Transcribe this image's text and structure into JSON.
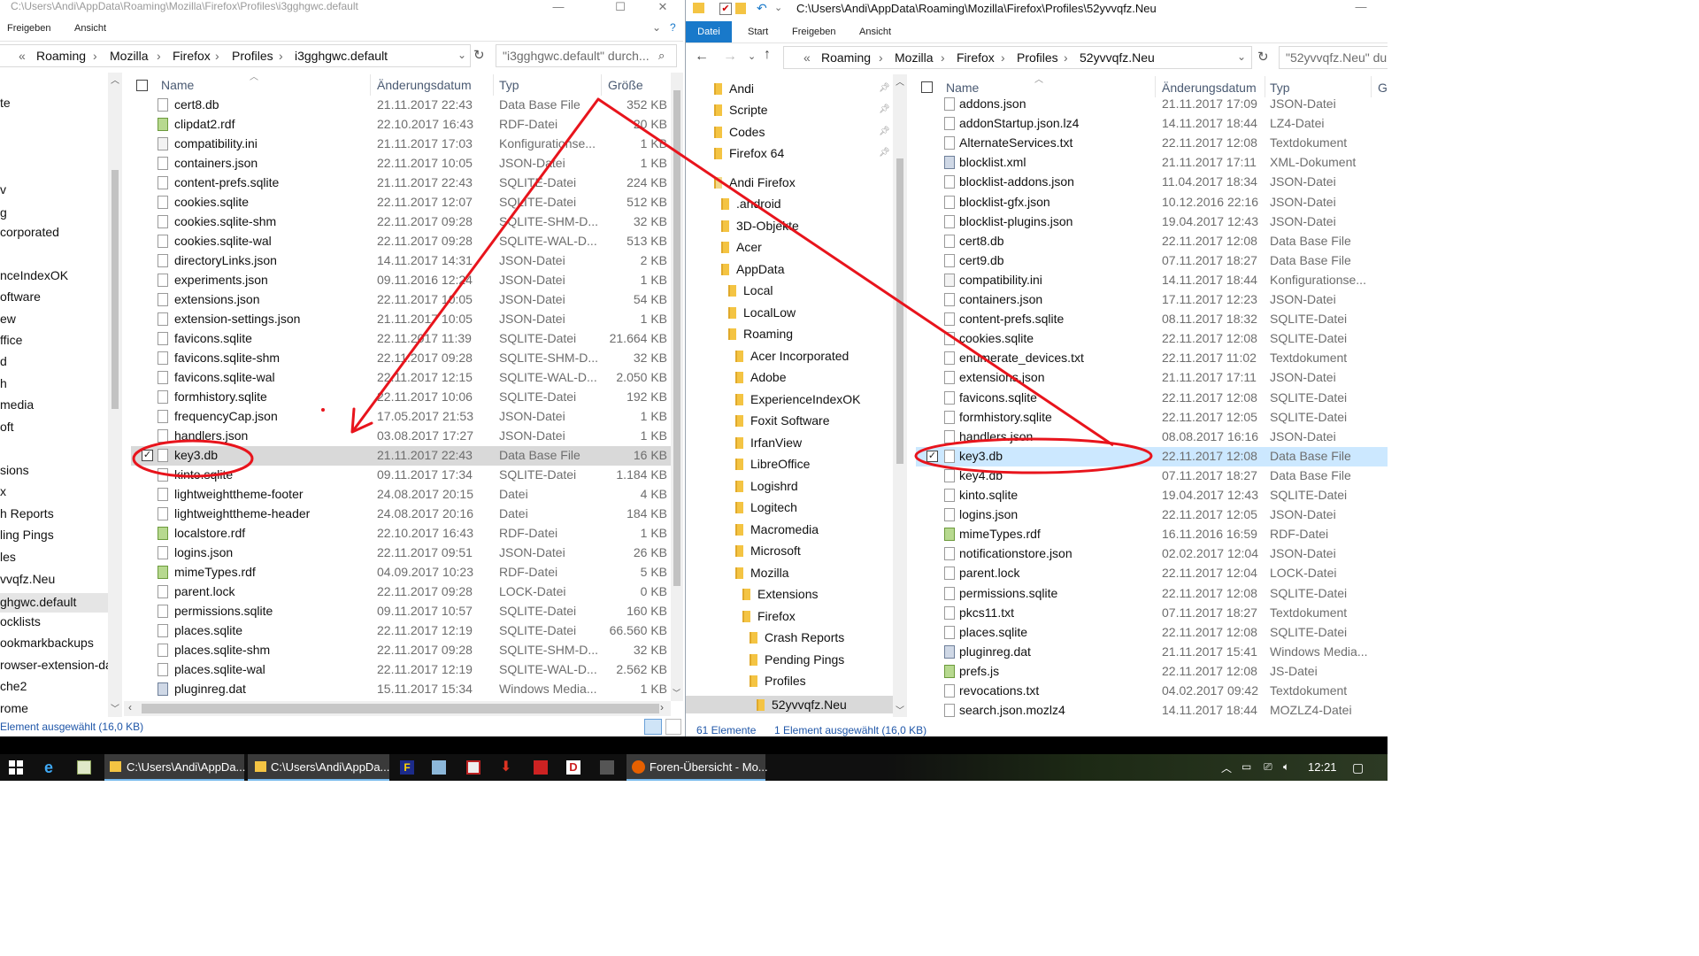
{
  "left_window": {
    "title": "C:\\Users\\Andi\\AppData\\Roaming\\Mozilla\\Firefox\\Profiles\\i3gghgwc.default",
    "ribbon_tabs": [
      "Freigeben",
      "Ansicht"
    ],
    "breadcrumb": [
      "«",
      "Roaming",
      "Mozilla",
      "Firefox",
      "Profiles",
      "i3gghgwc.default"
    ],
    "search_placeholder": "\"i3gghgwc.default\" durch...",
    "nav_items": [
      "te",
      "v",
      "g",
      "corporated",
      "nceIndexOK",
      "oftware",
      "ew",
      "ffice",
      "d",
      "h",
      "media",
      "oft",
      "sions",
      "x",
      "h Reports",
      "ling Pings",
      "les",
      "vvqfz.Neu",
      "ghgwc.default",
      "ocklists",
      "ookmarkbackups",
      "rowser-extension-da",
      "che2",
      "rome"
    ],
    "selected_nav": "ghgwc.default",
    "columns": {
      "name": "Name",
      "date": "Änderungsdatum",
      "type": "Typ",
      "size": "Größe"
    },
    "files": [
      {
        "name": "cert8.db",
        "date": "21.11.2017 22:43",
        "type": "Data Base File",
        "size": "352 KB",
        "icon": "db"
      },
      {
        "name": "clipdat2.rdf",
        "date": "22.10.2017 16:43",
        "type": "RDF-Datei",
        "size": "20 KB",
        "icon": "rdf"
      },
      {
        "name": "compatibility.ini",
        "date": "21.11.2017 17:03",
        "type": "Konfigurationse...",
        "size": "1 KB",
        "icon": "ini"
      },
      {
        "name": "containers.json",
        "date": "22.11.2017 10:05",
        "type": "JSON-Datei",
        "size": "1 KB",
        "icon": "file"
      },
      {
        "name": "content-prefs.sqlite",
        "date": "21.11.2017 22:43",
        "type": "SQLITE-Datei",
        "size": "224 KB",
        "icon": "file"
      },
      {
        "name": "cookies.sqlite",
        "date": "22.11.2017 12:07",
        "type": "SQLITE-Datei",
        "size": "512 KB",
        "icon": "file"
      },
      {
        "name": "cookies.sqlite-shm",
        "date": "22.11.2017 09:28",
        "type": "SQLITE-SHM-D...",
        "size": "32 KB",
        "icon": "file"
      },
      {
        "name": "cookies.sqlite-wal",
        "date": "22.11.2017 09:28",
        "type": "SQLITE-WAL-D...",
        "size": "513 KB",
        "icon": "file"
      },
      {
        "name": "directoryLinks.json",
        "date": "14.11.2017 14:31",
        "type": "JSON-Datei",
        "size": "2 KB",
        "icon": "file"
      },
      {
        "name": "experiments.json",
        "date": "09.11.2016 12:24",
        "type": "JSON-Datei",
        "size": "1 KB",
        "icon": "file"
      },
      {
        "name": "extensions.json",
        "date": "22.11.2017 10:05",
        "type": "JSON-Datei",
        "size": "54 KB",
        "icon": "file"
      },
      {
        "name": "extension-settings.json",
        "date": "21.11.2017 10:05",
        "type": "JSON-Datei",
        "size": "1 KB",
        "icon": "file"
      },
      {
        "name": "favicons.sqlite",
        "date": "22.11.2017 11:39",
        "type": "SQLITE-Datei",
        "size": "21.664 KB",
        "icon": "file"
      },
      {
        "name": "favicons.sqlite-shm",
        "date": "22.11.2017 09:28",
        "type": "SQLITE-SHM-D...",
        "size": "32 KB",
        "icon": "file"
      },
      {
        "name": "favicons.sqlite-wal",
        "date": "22.11.2017 12:15",
        "type": "SQLITE-WAL-D...",
        "size": "2.050 KB",
        "icon": "file"
      },
      {
        "name": "formhistory.sqlite",
        "date": "22.11.2017 10:06",
        "type": "SQLITE-Datei",
        "size": "192 KB",
        "icon": "file"
      },
      {
        "name": "frequencyCap.json",
        "date": "17.05.2017 21:53",
        "type": "JSON-Datei",
        "size": "1 KB",
        "icon": "file"
      },
      {
        "name": "handlers.json",
        "date": "03.08.2017 17:27",
        "type": "JSON-Datei",
        "size": "1 KB",
        "icon": "file"
      },
      {
        "name": "key3.db",
        "date": "21.11.2017 22:43",
        "type": "Data Base File",
        "size": "16 KB",
        "icon": "db",
        "selected": true
      },
      {
        "name": "kinto.sqlite",
        "date": "09.11.2017 17:34",
        "type": "SQLITE-Datei",
        "size": "1.184 KB",
        "icon": "file"
      },
      {
        "name": "lightweighttheme-footer",
        "date": "24.08.2017 20:15",
        "type": "Datei",
        "size": "4 KB",
        "icon": "file"
      },
      {
        "name": "lightweighttheme-header",
        "date": "24.08.2017 20:16",
        "type": "Datei",
        "size": "184 KB",
        "icon": "file"
      },
      {
        "name": "localstore.rdf",
        "date": "22.10.2017 16:43",
        "type": "RDF-Datei",
        "size": "1 KB",
        "icon": "rdf"
      },
      {
        "name": "logins.json",
        "date": "22.11.2017 09:51",
        "type": "JSON-Datei",
        "size": "26 KB",
        "icon": "file"
      },
      {
        "name": "mimeTypes.rdf",
        "date": "04.09.2017 10:23",
        "type": "RDF-Datei",
        "size": "5 KB",
        "icon": "rdf"
      },
      {
        "name": "parent.lock",
        "date": "22.11.2017 09:28",
        "type": "LOCK-Datei",
        "size": "0 KB",
        "icon": "file"
      },
      {
        "name": "permissions.sqlite",
        "date": "09.11.2017 10:57",
        "type": "SQLITE-Datei",
        "size": "160 KB",
        "icon": "file"
      },
      {
        "name": "places.sqlite",
        "date": "22.11.2017 12:19",
        "type": "SQLITE-Datei",
        "size": "66.560 KB",
        "icon": "file"
      },
      {
        "name": "places.sqlite-shm",
        "date": "22.11.2017 09:28",
        "type": "SQLITE-SHM-D...",
        "size": "32 KB",
        "icon": "file"
      },
      {
        "name": "places.sqlite-wal",
        "date": "22.11.2017 12:19",
        "type": "SQLITE-WAL-D...",
        "size": "2.562 KB",
        "icon": "file"
      },
      {
        "name": "pluginreg.dat",
        "date": "15.11.2017 15:34",
        "type": "Windows Media...",
        "size": "1 KB",
        "icon": "app"
      }
    ],
    "status": "Element ausgewählt (16,0 KB)"
  },
  "right_window": {
    "title": "C:\\Users\\Andi\\AppData\\Roaming\\Mozilla\\Firefox\\Profiles\\52yvvqfz.Neu",
    "ribbon_tabs": [
      "Datei",
      "Start",
      "Freigeben",
      "Ansicht"
    ],
    "breadcrumb": [
      "«",
      "Roaming",
      "Mozilla",
      "Firefox",
      "Profiles",
      "52yvvqfz.Neu"
    ],
    "search_placeholder": "\"52yvvqfz.Neu\" du",
    "nav_items": [
      {
        "label": "Andi",
        "indent": 0,
        "pin": true
      },
      {
        "label": "Scripte",
        "indent": 0,
        "pin": true
      },
      {
        "label": "Codes",
        "indent": 0,
        "pin": true
      },
      {
        "label": "Firefox 64",
        "indent": 0,
        "pin": true
      },
      {
        "label": "Andi Firefox",
        "indent": 0,
        "pin": false
      },
      {
        "label": ".android",
        "indent": 1,
        "pin": false
      },
      {
        "label": "3D-Objekte",
        "indent": 1,
        "pin": false
      },
      {
        "label": "Acer",
        "indent": 1,
        "pin": false
      },
      {
        "label": "AppData",
        "indent": 1,
        "pin": false
      },
      {
        "label": "Local",
        "indent": 2,
        "pin": false
      },
      {
        "label": "LocalLow",
        "indent": 2,
        "pin": false
      },
      {
        "label": "Roaming",
        "indent": 2,
        "pin": false
      },
      {
        "label": "Acer Incorporated",
        "indent": 3,
        "pin": false
      },
      {
        "label": "Adobe",
        "indent": 3,
        "pin": false
      },
      {
        "label": "ExperienceIndexOK",
        "indent": 3,
        "pin": false
      },
      {
        "label": "Foxit Software",
        "indent": 3,
        "pin": false
      },
      {
        "label": "IrfanView",
        "indent": 3,
        "pin": false
      },
      {
        "label": "LibreOffice",
        "indent": 3,
        "pin": false
      },
      {
        "label": "Logishrd",
        "indent": 3,
        "pin": false
      },
      {
        "label": "Logitech",
        "indent": 3,
        "pin": false
      },
      {
        "label": "Macromedia",
        "indent": 3,
        "pin": false
      },
      {
        "label": "Microsoft",
        "indent": 3,
        "pin": false
      },
      {
        "label": "Mozilla",
        "indent": 3,
        "pin": false
      },
      {
        "label": "Extensions",
        "indent": 4,
        "pin": false
      },
      {
        "label": "Firefox",
        "indent": 4,
        "pin": false
      },
      {
        "label": "Crash Reports",
        "indent": 5,
        "pin": false
      },
      {
        "label": "Pending Pings",
        "indent": 5,
        "pin": false
      },
      {
        "label": "Profiles",
        "indent": 5,
        "pin": false
      },
      {
        "label": "52yvvqfz.Neu",
        "indent": 6,
        "pin": false,
        "selected": true
      }
    ],
    "columns": {
      "name": "Name",
      "date": "Änderungsdatum",
      "type": "Typ",
      "size": "Gi"
    },
    "files": [
      {
        "name": "addons.json",
        "date": "21.11.2017 17:09",
        "type": "JSON-Datei",
        "icon": "file"
      },
      {
        "name": "addonStartup.json.lz4",
        "date": "14.11.2017 18:44",
        "type": "LZ4-Datei",
        "icon": "file"
      },
      {
        "name": "AlternateServices.txt",
        "date": "22.11.2017 12:08",
        "type": "Textdokument",
        "icon": "file"
      },
      {
        "name": "blocklist.xml",
        "date": "21.11.2017 17:11",
        "type": "XML-Dokument",
        "icon": "app"
      },
      {
        "name": "blocklist-addons.json",
        "date": "11.04.2017 18:34",
        "type": "JSON-Datei",
        "icon": "file"
      },
      {
        "name": "blocklist-gfx.json",
        "date": "10.12.2016 22:16",
        "type": "JSON-Datei",
        "icon": "file"
      },
      {
        "name": "blocklist-plugins.json",
        "date": "19.04.2017 12:43",
        "type": "JSON-Datei",
        "icon": "file"
      },
      {
        "name": "cert8.db",
        "date": "22.11.2017 12:08",
        "type": "Data Base File",
        "icon": "db"
      },
      {
        "name": "cert9.db",
        "date": "07.11.2017 18:27",
        "type": "Data Base File",
        "icon": "db"
      },
      {
        "name": "compatibility.ini",
        "date": "14.11.2017 18:44",
        "type": "Konfigurationse...",
        "icon": "ini"
      },
      {
        "name": "containers.json",
        "date": "17.11.2017 12:23",
        "type": "JSON-Datei",
        "icon": "file"
      },
      {
        "name": "content-prefs.sqlite",
        "date": "08.11.2017 18:32",
        "type": "SQLITE-Datei",
        "icon": "file"
      },
      {
        "name": "cookies.sqlite",
        "date": "22.11.2017 12:08",
        "type": "SQLITE-Datei",
        "icon": "file"
      },
      {
        "name": "enumerate_devices.txt",
        "date": "22.11.2017 11:02",
        "type": "Textdokument",
        "icon": "file"
      },
      {
        "name": "extensions.json",
        "date": "21.11.2017 17:11",
        "type": "JSON-Datei",
        "icon": "file"
      },
      {
        "name": "favicons.sqlite",
        "date": "22.11.2017 12:08",
        "type": "SQLITE-Datei",
        "icon": "file"
      },
      {
        "name": "formhistory.sqlite",
        "date": "22.11.2017 12:05",
        "type": "SQLITE-Datei",
        "icon": "file"
      },
      {
        "name": "handlers.json",
        "date": "08.08.2017 16:16",
        "type": "JSON-Datei",
        "icon": "file"
      },
      {
        "name": "key3.db",
        "date": "22.11.2017 12:08",
        "type": "Data Base File",
        "icon": "db",
        "selected": true
      },
      {
        "name": "key4.db",
        "date": "07.11.2017 18:27",
        "type": "Data Base File",
        "icon": "db"
      },
      {
        "name": "kinto.sqlite",
        "date": "19.04.2017 12:43",
        "type": "SQLITE-Datei",
        "icon": "file"
      },
      {
        "name": "logins.json",
        "date": "22.11.2017 12:05",
        "type": "JSON-Datei",
        "icon": "file"
      },
      {
        "name": "mimeTypes.rdf",
        "date": "16.11.2016 16:59",
        "type": "RDF-Datei",
        "icon": "rdf"
      },
      {
        "name": "notificationstore.json",
        "date": "02.02.2017 12:04",
        "type": "JSON-Datei",
        "icon": "file"
      },
      {
        "name": "parent.lock",
        "date": "22.11.2017 12:04",
        "type": "LOCK-Datei",
        "icon": "file"
      },
      {
        "name": "permissions.sqlite",
        "date": "22.11.2017 12:08",
        "type": "SQLITE-Datei",
        "icon": "file"
      },
      {
        "name": "pkcs11.txt",
        "date": "07.11.2017 18:27",
        "type": "Textdokument",
        "icon": "file"
      },
      {
        "name": "places.sqlite",
        "date": "22.11.2017 12:08",
        "type": "SQLITE-Datei",
        "icon": "file"
      },
      {
        "name": "pluginreg.dat",
        "date": "21.11.2017 15:41",
        "type": "Windows Media...",
        "icon": "app"
      },
      {
        "name": "prefs.js",
        "date": "22.11.2017 12:08",
        "type": "JS-Datei",
        "icon": "rdf"
      },
      {
        "name": "revocations.txt",
        "date": "04.02.2017 09:42",
        "type": "Textdokument",
        "icon": "file"
      },
      {
        "name": "search.json.mozlz4",
        "date": "14.11.2017 18:44",
        "type": "MOZLZ4-Datei",
        "icon": "file"
      }
    ],
    "status_count": "61 Elemente",
    "status_selected": "1 Element ausgewählt (16,0 KB)"
  },
  "taskbar": {
    "items": [
      {
        "label": "C:\\Users\\Andi\\AppDa...",
        "active": true
      },
      {
        "label": "C:\\Users\\Andi\\AppDa...",
        "active": true
      },
      {
        "label": "Foren-Übersicht - Mo...",
        "active": true
      }
    ],
    "clock": "12:21"
  },
  "colors": {
    "annotation_red": "#e8141c",
    "selection_blue": "#cce8ff",
    "selection_gray": "#d9d9d9",
    "ribbon_active": "#1979ca",
    "folder_yellow": "#f4c443"
  }
}
